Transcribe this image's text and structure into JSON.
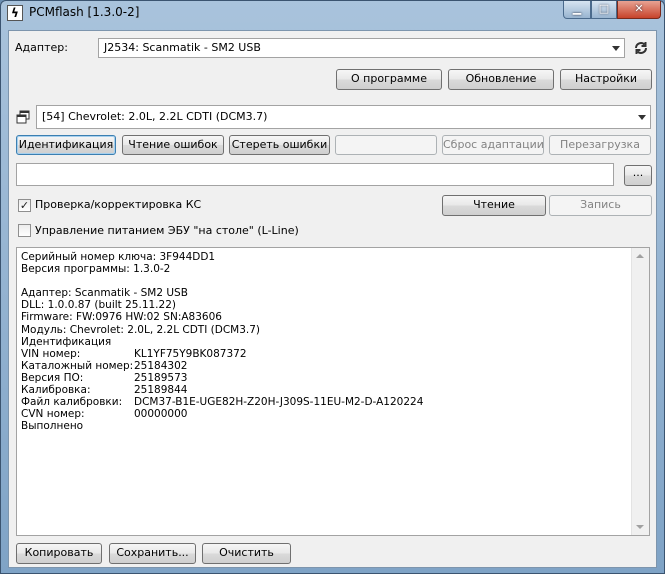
{
  "window": {
    "title": "PCMflash [1.3.0-2]",
    "controls": {
      "minimize": "▁",
      "maximize": "□",
      "close": "✕"
    }
  },
  "adapter": {
    "label": "Адаптер:",
    "selected": "J2534: Scanmatik - SM2 USB"
  },
  "top_buttons": {
    "about": "О программе",
    "update": "Обновление",
    "settings": "Настройки"
  },
  "module": {
    "selected": "[54] Chevrolet: 2.0L, 2.2L CDTI (DCM3.7)"
  },
  "action_buttons": {
    "identify": "Идентификация",
    "read_errors": "Чтение ошибок",
    "clear_errors": "Стереть ошибки",
    "blank": "",
    "reset_adaptation": "Сброс адаптации",
    "reboot": "Перезагрузка"
  },
  "file": {
    "path": "",
    "browse": "..."
  },
  "checksum": {
    "label": "Проверка/корректировка КС",
    "checked": true,
    "check_mark": "✓"
  },
  "rw_buttons": {
    "read": "Чтение",
    "write": "Запись"
  },
  "bench_power": {
    "label": "Управление питанием ЭБУ \"на столе\" (L-Line)",
    "checked": false
  },
  "log": {
    "lines": [
      {
        "text": "Серийный номер ключа: 3F944DD1"
      },
      {
        "text": "Версия программы: 1.3.0-2"
      },
      {
        "text": ""
      },
      {
        "text": "Адаптер: Scanmatik - SM2 USB"
      },
      {
        "text": "DLL: 1.0.0.87 (built 25.11.22)"
      },
      {
        "text": "Firmware: FW:0976 HW:02 SN:A83606"
      },
      {
        "text": "Модуль: Chevrolet: 2.0L, 2.2L CDTI (DCM3.7)"
      },
      {
        "text": "Идентификация"
      },
      {
        "key": "VIN номер:",
        "value": "KL1YF75Y9BK087372"
      },
      {
        "key": "Каталожный номер:",
        "value": "25184302"
      },
      {
        "key": "Версия ПО:",
        "value": "25189573"
      },
      {
        "key": "Калибровка:",
        "value": "25189844"
      },
      {
        "key": "Файл калибровки:",
        "value": "DCM37-B1E-UGE82H-Z20H-J309S-11EU-M2-D-A120224"
      },
      {
        "key": "CVN номер:",
        "value": "00000000"
      },
      {
        "text": "Выполнено"
      }
    ]
  },
  "bottom_buttons": {
    "copy": "Копировать",
    "save": "Сохранить...",
    "clear": "Очистить"
  }
}
